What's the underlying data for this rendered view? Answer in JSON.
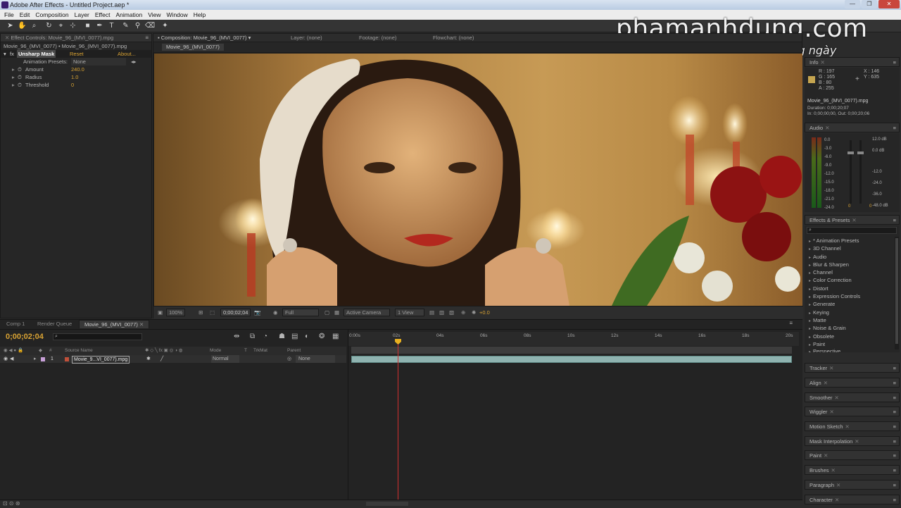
{
  "window": {
    "title": "Adobe After Effects - Untitled Project.aep *"
  },
  "menu": [
    "File",
    "Edit",
    "Composition",
    "Layer",
    "Effect",
    "Animation",
    "View",
    "Window",
    "Help"
  ],
  "watermark": {
    "site": "phamanhdung.com",
    "tagline": "Chia sẻ kinh nghiệm hàng ngày"
  },
  "effect_controls": {
    "tab": "Effect Controls: Movie_96_(MVI_0077).mpg",
    "breadcrumb": "Movie_96_(MVI_0077) • Movie_96_(MVI_0077).mpg",
    "effect_name": "Unsharp Mask",
    "reset": "Reset",
    "about": "About...",
    "presets_label": "Animation Presets:",
    "presets_value": "None",
    "params": [
      {
        "name": "Amount",
        "value": "240.0"
      },
      {
        "name": "Radius",
        "value": "1.0"
      },
      {
        "name": "Threshold",
        "value": "0"
      }
    ]
  },
  "composition": {
    "tab": "Composition: Movie_96_(MVI_0077)",
    "layer_tab": "Layer: (none)",
    "footage_tab": "Footage: (none)",
    "flowchart_tab": "Flowchart: (none)",
    "comp_button": "Movie_96_(MVI_0077)",
    "zoom": "100%",
    "timecode": "0;00;02;04",
    "resolution": "Full",
    "camera": "Active Camera",
    "view": "1 View",
    "exposure": "+0.0"
  },
  "info": {
    "tab": "Info",
    "R": "R : 197",
    "G": "G : 165",
    "B": "B : 80",
    "A": "A : 255",
    "X": "X : 146",
    "Y": "Y : 635",
    "color": "#c5a550",
    "file": "Movie_96_(MVI_0077).mpg",
    "duration": "Duration: 0;00;20;07",
    "inout": "In: 0;00;00;00, Out: 0;00;20;06"
  },
  "audio": {
    "tab": "Audio",
    "left_scale": [
      "0.0",
      "-3.0",
      "-6.0",
      "-9.0",
      "-12.0",
      "-15.0",
      "-18.0",
      "-21.0",
      "-24.0"
    ],
    "right_scale": [
      "12.0 dB",
      "0.0 dB",
      "-12.0",
      "-24.0",
      "-36.0",
      "-48.0 dB"
    ],
    "l_value": "0",
    "r_value": "0"
  },
  "effects_presets": {
    "tab": "Effects & Presets",
    "items": [
      "* Animation Presets",
      "3D Channel",
      "Audio",
      "Blur & Sharpen",
      "Channel",
      "Color Correction",
      "Distort",
      "Expression Controls",
      "Generate",
      "Keying",
      "Matte",
      "Noise & Grain",
      "Obsolete",
      "Paint",
      "Perspective"
    ]
  },
  "collapsed_panels": [
    "Tracker",
    "Align",
    "Smoother",
    "Wiggler",
    "Motion Sketch",
    "Mask Interpolation",
    "Paint",
    "Brushes",
    "Paragraph",
    "Character"
  ],
  "timeline": {
    "tabs": [
      "Comp 1",
      "Render Queue",
      "Movie_96_(MVI_0077)"
    ],
    "timecode": "0;00;02;04",
    "columns": {
      "source": "Source Name",
      "mode": "Mode",
      "t": "T",
      "trkmat": "TrkMat",
      "parent": "Parent"
    },
    "layer": {
      "num": "1",
      "name": "Movie_9...VI_0077).mpg",
      "mode": "Normal",
      "parent": "None"
    },
    "ruler": [
      "0:00s",
      "02s",
      "04s",
      "06s",
      "08s",
      "10s",
      "12s",
      "14s",
      "16s",
      "18s",
      "20s"
    ],
    "playhead_seconds": 2.13,
    "duration_seconds": 20.23
  }
}
